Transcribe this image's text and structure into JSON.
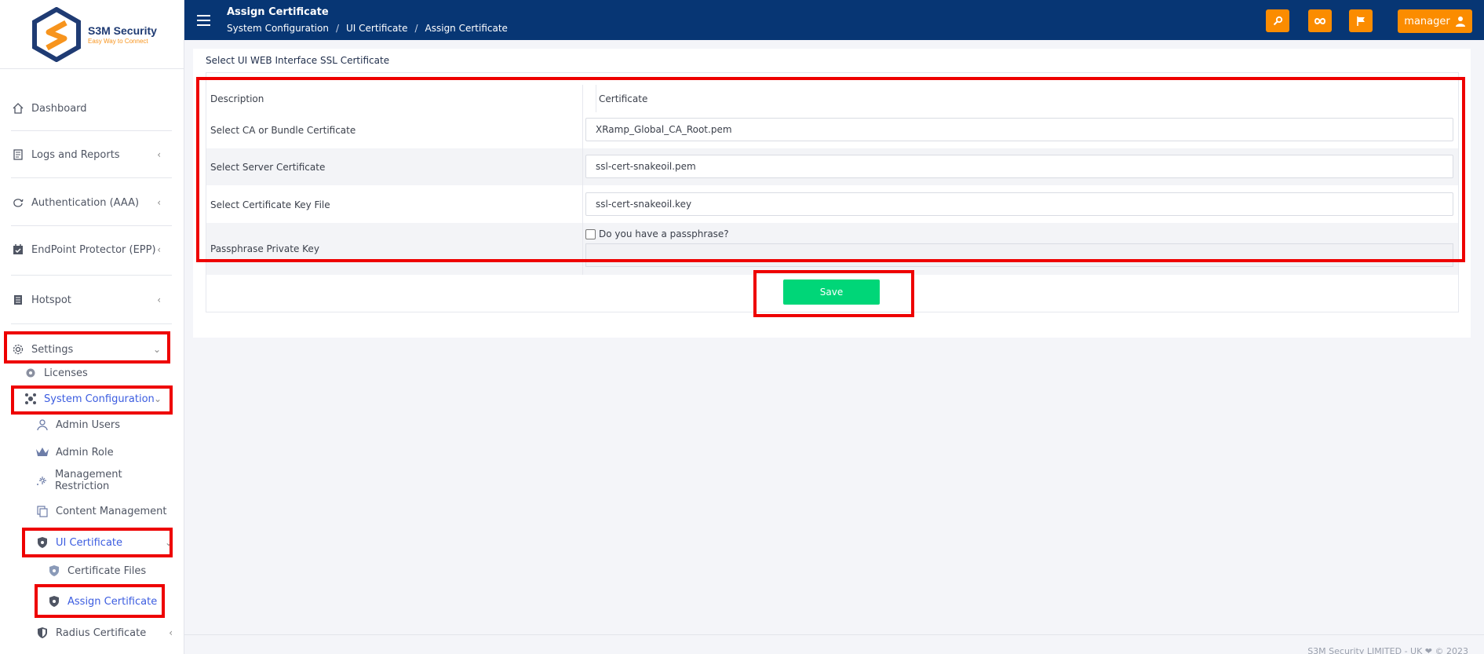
{
  "brand": {
    "name": "S3M Security",
    "tagline": "Easy Way to Connect",
    "primary": "#073674",
    "accent": "#fb8c00"
  },
  "sidebar": {
    "items": [
      {
        "label": "Dashboard",
        "icon": "home-icon"
      },
      {
        "label": "Logs and Reports",
        "icon": "report-icon"
      },
      {
        "label": "Authentication (AAA)",
        "icon": "sync-icon"
      },
      {
        "label": "EndPoint Protector (EPP)",
        "icon": "calendar-check-icon"
      },
      {
        "label": "Hotspot",
        "icon": "list-icon"
      },
      {
        "label": "Settings",
        "icon": "gear-icon"
      }
    ],
    "settings_children": {
      "licenses": "Licenses",
      "system_configuration": "System Configuration",
      "system_children": {
        "admin_users": "Admin Users",
        "admin_role": "Admin Role",
        "management_restriction": "Management Restriction",
        "content_management": "Content Management",
        "ui_certificate": "UI Certificate",
        "ui_children": {
          "certificate_files": "Certificate Files",
          "assign_certificate": "Assign Certificate"
        },
        "radius_certificate": "Radius Certificate"
      }
    }
  },
  "header": {
    "title": "Assign Certificate",
    "breadcrumb": [
      "System Configuration",
      "UI Certificate",
      "Assign Certificate"
    ],
    "user": "manager"
  },
  "main": {
    "card_title": "Select UI WEB Interface SSL Certificate",
    "table": {
      "headers": [
        "Description",
        "Certificate"
      ],
      "rows": [
        {
          "label": "Select CA or Bundle Certificate",
          "value": "XRamp_Global_CA_Root.pem"
        },
        {
          "label": "Select Server Certificate",
          "value": "ssl-cert-snakeoil.pem"
        },
        {
          "label": "Select Certificate Key File",
          "value": "ssl-cert-snakeoil.key"
        },
        {
          "label": "Passphrase Private Key",
          "checkbox_label": "Do you have a passphrase?"
        }
      ]
    },
    "save_label": "Save"
  },
  "footer": {
    "text": "S3M Security LIMITED - UK ❤ © 2023"
  }
}
